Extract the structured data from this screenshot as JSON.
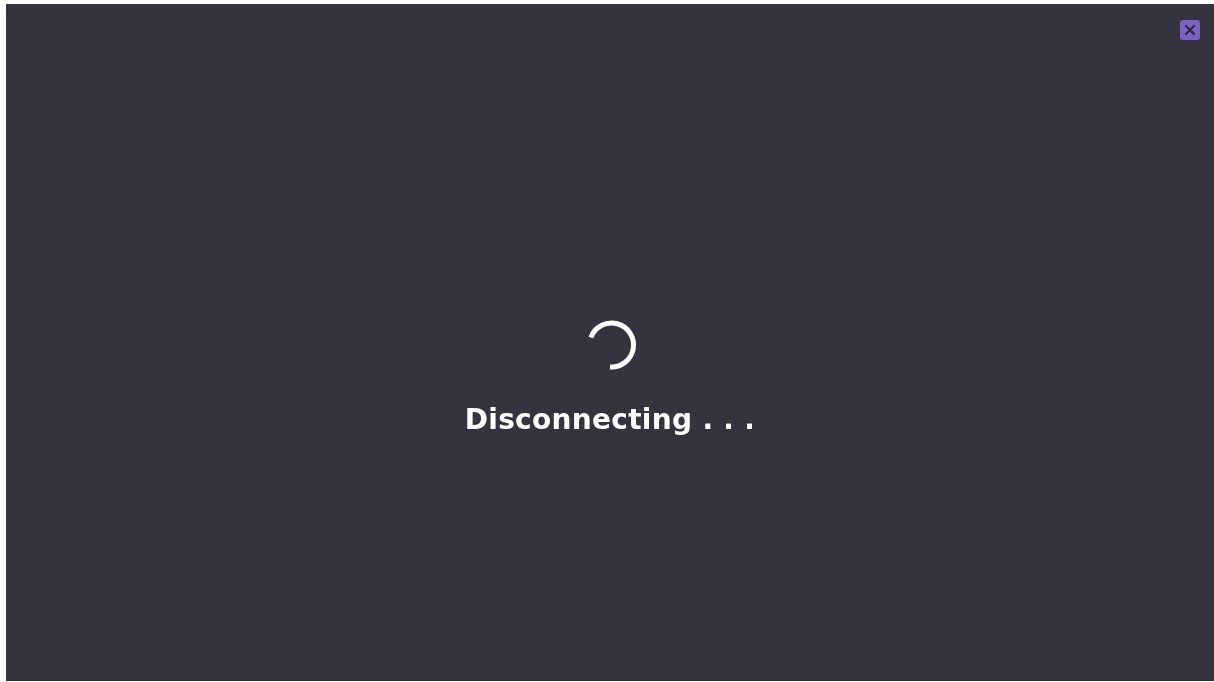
{
  "overlay": {
    "message": "Disconnecting . . ."
  }
}
